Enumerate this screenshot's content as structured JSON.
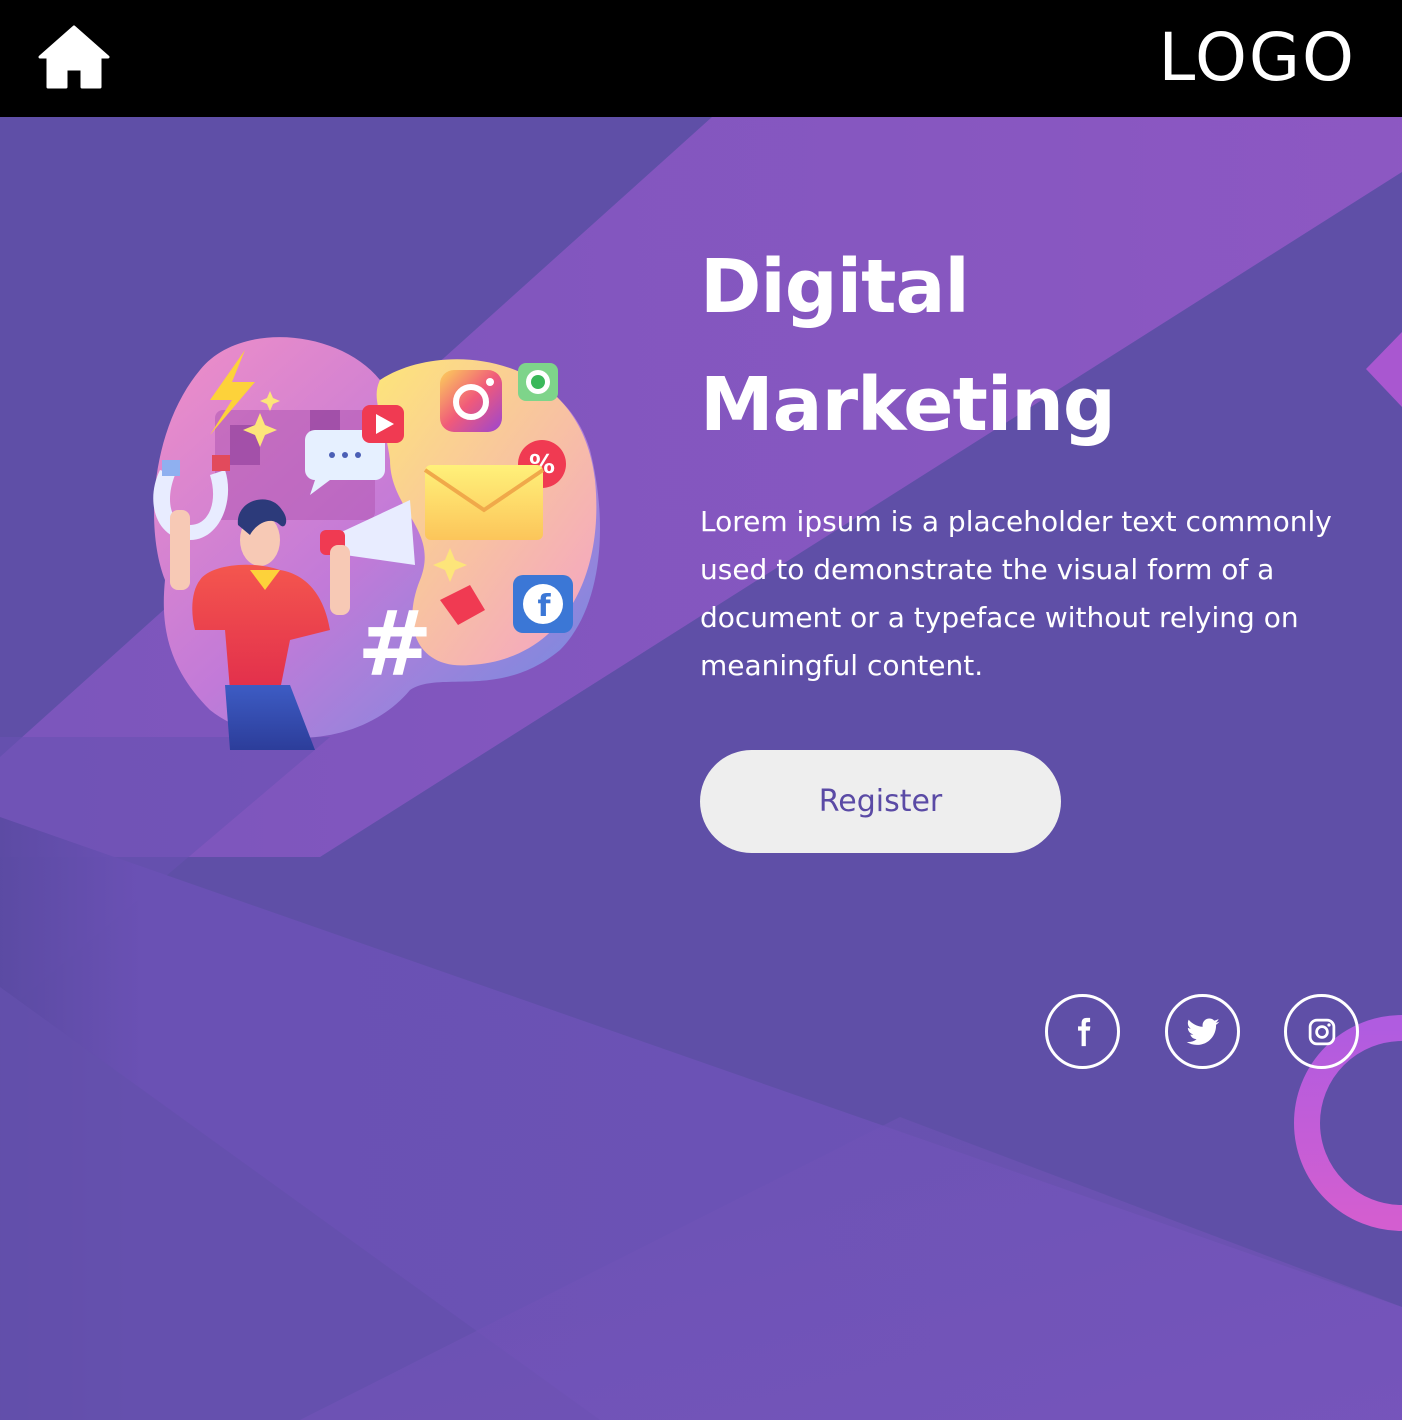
{
  "header": {
    "logo_text": "LOGO",
    "home_icon": "home-icon"
  },
  "hero": {
    "title_line1": "Digital",
    "title_line2": "Marketing",
    "description": "Lorem ipsum is a placeholder text commonly used to demonstrate the visual form of a document or a typeface without relying on meaningful content.",
    "register_label": "Register"
  },
  "social": [
    {
      "name": "facebook",
      "icon": "facebook-icon"
    },
    {
      "name": "twitter",
      "icon": "twitter-icon"
    },
    {
      "name": "instagram",
      "icon": "instagram-icon"
    }
  ],
  "colors": {
    "header_bg": "#000000",
    "hero_bg": "#5e4fa8",
    "accent_light": "#8c55c2",
    "button_bg": "#eeeeee",
    "button_text": "#5a4aa5",
    "ring": "#c25bd6"
  }
}
